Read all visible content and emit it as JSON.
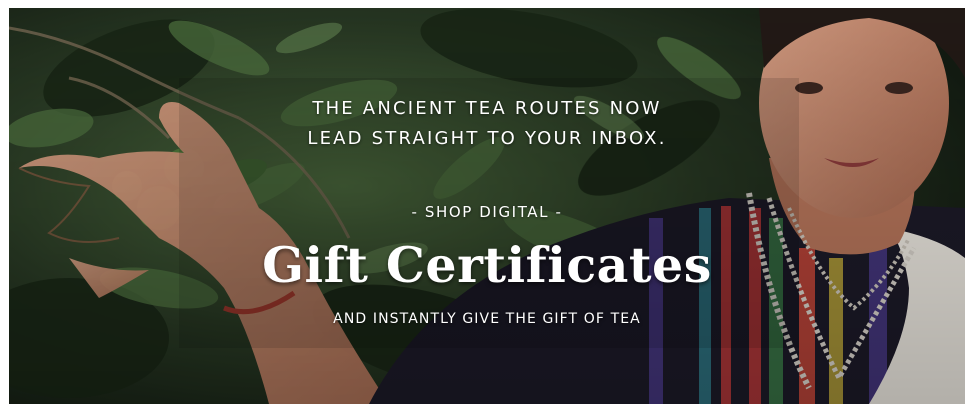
{
  "banner": {
    "headline_line1": "THE ANCIENT TEA ROUTES NOW",
    "headline_line2": "LEAD STRAIGHT TO YOUR INBOX.",
    "kicker": "- SHOP DIGITAL -",
    "title": "Gift Certificates",
    "subline": "AND INSTANTLY GIVE THE GIFT OF TEA",
    "photo_description_icon": "tea-picker-photo",
    "colors": {
      "text": "#ffffff",
      "foliage_dark": "#1d2a1c",
      "foliage_mid": "#3e5a33",
      "skin": "#c98c70",
      "garment_dark": "#1c1a28"
    }
  }
}
